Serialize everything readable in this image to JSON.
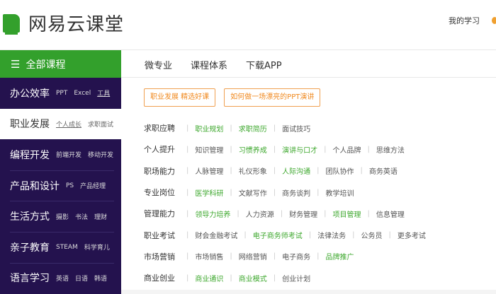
{
  "header": {
    "logo_text": "网易云课堂",
    "my_study": "我的学习"
  },
  "nav": {
    "all_courses": "全部课程",
    "menu_icon": "hamburger-icon",
    "links": [
      "微专业",
      "课程体系",
      "下载APP"
    ]
  },
  "colors": {
    "brand_green": "#33a02c",
    "sidebar_bg": "#24124e",
    "highlight_green": "#3ea82e",
    "tag_orange": "#f08a20"
  },
  "sidebar": [
    {
      "title": "办公效率",
      "subs": [
        "PPT",
        "Excel",
        "工具"
      ]
    },
    {
      "title": "职业发展",
      "subs": [
        "个人成长",
        "求职面试"
      ],
      "active": true
    },
    {
      "title": "编程开发",
      "subs": [
        "前端开发",
        "移动开发"
      ]
    },
    {
      "title": "产品和设计",
      "subs": [
        "PS",
        "产品经理"
      ]
    },
    {
      "title": "生活方式",
      "subs": [
        "摄影",
        "书法",
        "理财"
      ]
    },
    {
      "title": "亲子教育",
      "subs": [
        "STEAM",
        "科学育儿"
      ]
    },
    {
      "title": "语言学习",
      "subs": [
        "英语",
        "日语",
        "韩语"
      ]
    }
  ],
  "tags": [
    "职业发展 精选好课",
    "如何做一场漂亮的PPT演讲"
  ],
  "categories": [
    {
      "title": "求职应聘",
      "items": [
        {
          "t": "职业规划",
          "hl": true
        },
        {
          "t": "求职简历",
          "hl": true
        },
        {
          "t": "面试技巧"
        }
      ]
    },
    {
      "title": "个人提升",
      "items": [
        {
          "t": "知识管理"
        },
        {
          "t": "习惯养成",
          "hl": true
        },
        {
          "t": "演讲与口才",
          "hl": true
        },
        {
          "t": "个人品牌"
        },
        {
          "t": "思维方法"
        }
      ]
    },
    {
      "title": "职场能力",
      "items": [
        {
          "t": "人脉管理"
        },
        {
          "t": "礼仪形象"
        },
        {
          "t": "人际沟通",
          "hl": true
        },
        {
          "t": "团队协作"
        },
        {
          "t": "商务英语"
        }
      ]
    },
    {
      "title": "专业岗位",
      "items": [
        {
          "t": "医学科研",
          "hl": true
        },
        {
          "t": "文献写作"
        },
        {
          "t": "商务谈判"
        },
        {
          "t": "教学培训"
        }
      ]
    },
    {
      "title": "管理能力",
      "items": [
        {
          "t": "领导力培养",
          "hl": true
        },
        {
          "t": "人力资源"
        },
        {
          "t": "财务管理"
        },
        {
          "t": "项目管理",
          "hl": true
        },
        {
          "t": "信息管理"
        }
      ]
    },
    {
      "title": "职业考试",
      "items": [
        {
          "t": "财会金融考试"
        },
        {
          "t": "电子商务师考试",
          "hl": true
        },
        {
          "t": "法律法务"
        },
        {
          "t": "公务员"
        },
        {
          "t": "更多考试"
        }
      ]
    },
    {
      "title": "市场营销",
      "items": [
        {
          "t": "市场销售"
        },
        {
          "t": "网络营销"
        },
        {
          "t": "电子商务"
        },
        {
          "t": "品牌推广",
          "hl": true
        }
      ]
    },
    {
      "title": "商业创业",
      "items": [
        {
          "t": "商业通识",
          "hl": true
        },
        {
          "t": "商业模式",
          "hl": true
        },
        {
          "t": "创业计划"
        }
      ]
    }
  ]
}
